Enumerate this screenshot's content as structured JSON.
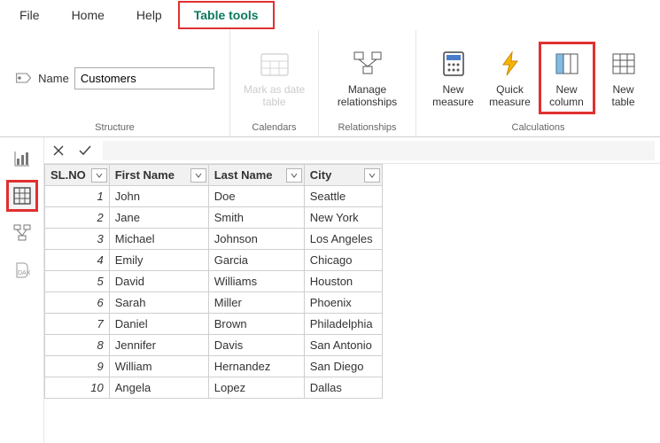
{
  "menu": {
    "items": [
      "File",
      "Home",
      "Help",
      "Table tools"
    ],
    "active_index": 3
  },
  "ribbon": {
    "name_label": "Name",
    "name_value": "Customers",
    "groups": {
      "structure": "Structure",
      "calendars": "Calendars",
      "relationships": "Relationships",
      "calculations": "Calculations"
    },
    "buttons": {
      "mark_as_date": "Mark as date\ntable",
      "manage_rel": "Manage\nrelationships",
      "new_measure": "New\nmeasure",
      "quick_measure": "Quick\nmeasure",
      "new_column": "New\ncolumn",
      "new_table": "New\ntable"
    }
  },
  "table": {
    "columns": [
      "SL.NO",
      "First Name",
      "Last Name",
      "City"
    ],
    "rows": [
      {
        "slno": 1,
        "first": "John",
        "last": "Doe",
        "city": "Seattle"
      },
      {
        "slno": 2,
        "first": "Jane",
        "last": "Smith",
        "city": "New York"
      },
      {
        "slno": 3,
        "first": "Michael",
        "last": "Johnson",
        "city": "Los Angeles"
      },
      {
        "slno": 4,
        "first": "Emily",
        "last": "Garcia",
        "city": "Chicago"
      },
      {
        "slno": 5,
        "first": "David",
        "last": "Williams",
        "city": "Houston"
      },
      {
        "slno": 6,
        "first": "Sarah",
        "last": "Miller",
        "city": "Phoenix"
      },
      {
        "slno": 7,
        "first": "Daniel",
        "last": "Brown",
        "city": "Philadelphia"
      },
      {
        "slno": 8,
        "first": "Jennifer",
        "last": "Davis",
        "city": "San Antonio"
      },
      {
        "slno": 9,
        "first": "William",
        "last": "Hernandez",
        "city": "San Diego"
      },
      {
        "slno": 10,
        "first": "Angela",
        "last": "Lopez",
        "city": "Dallas"
      }
    ]
  }
}
